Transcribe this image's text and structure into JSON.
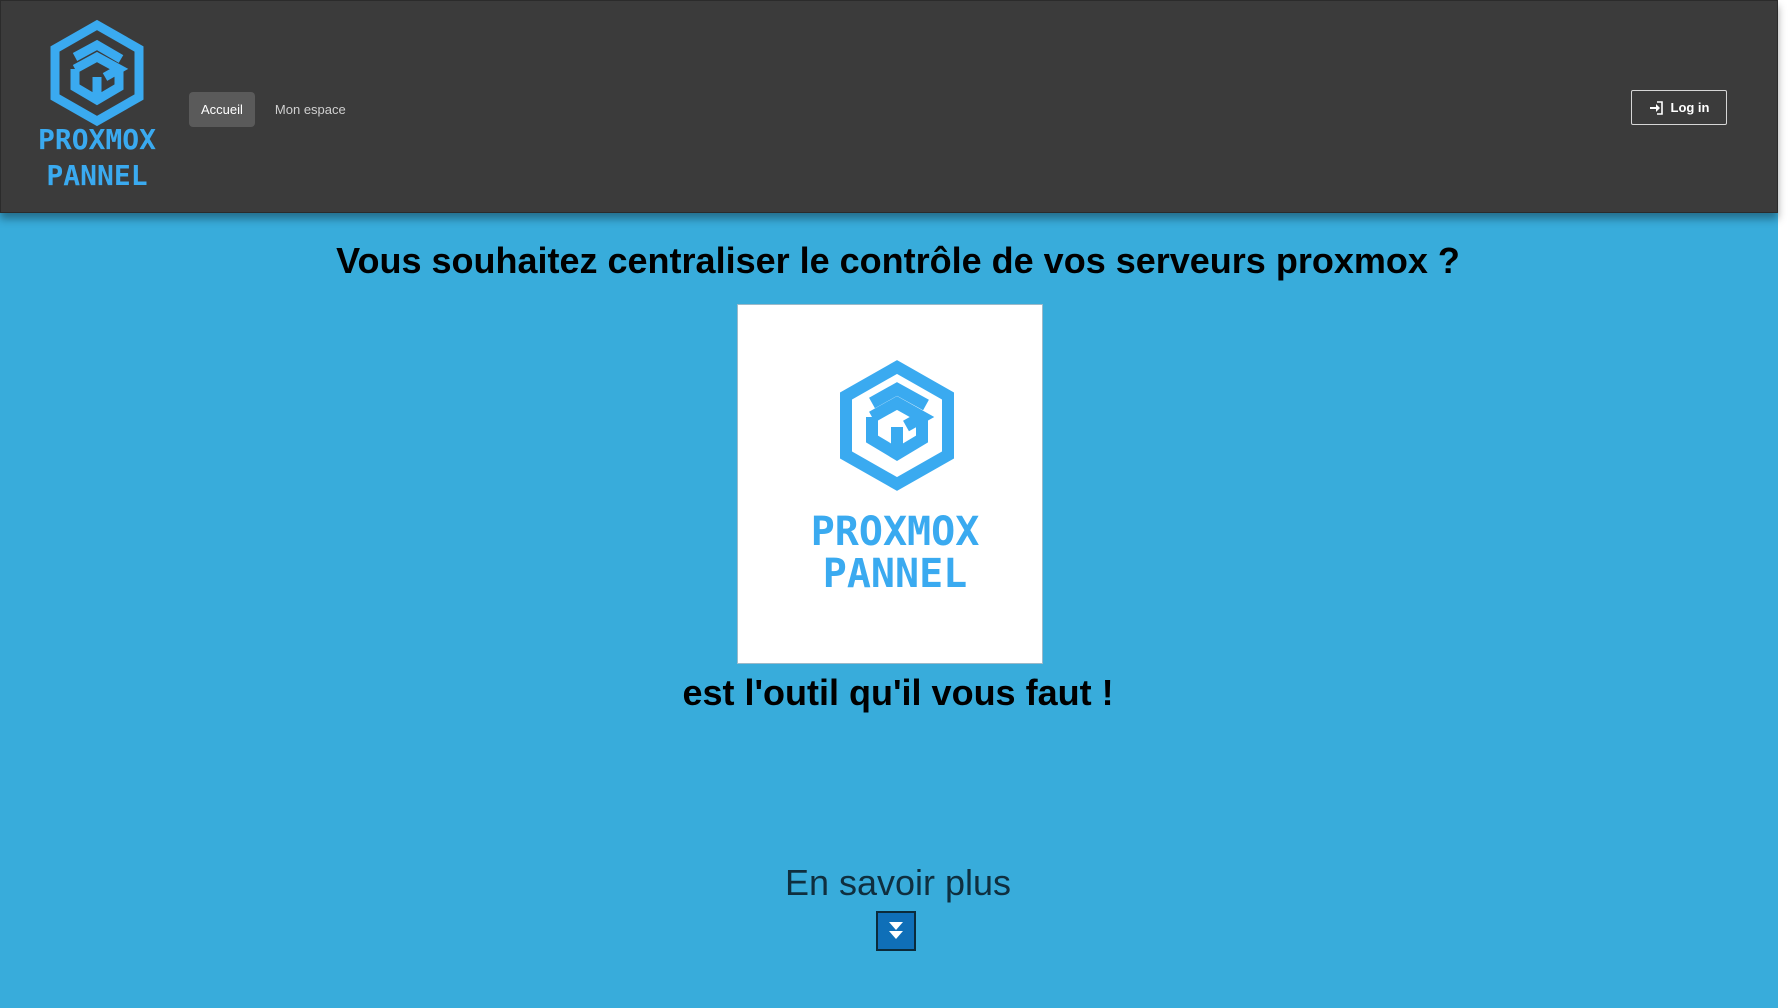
{
  "brand": {
    "logo_line1": "PROXMOX",
    "logo_line2": "PANNEL",
    "icon": "proxmox-pannel-cube-icon",
    "accent_color": "#3aaaf0"
  },
  "nav": {
    "items": [
      {
        "label": "Accueil",
        "active": true
      },
      {
        "label": "Mon espace",
        "active": false
      }
    ]
  },
  "login": {
    "label": "Log in",
    "icon": "sign-in-icon"
  },
  "hero": {
    "headline": "Vous souhaitez centraliser le contrôle de vos serveurs proxmox ?",
    "tagline": "est l'outil qu'il vous faut !",
    "logo_line1": "PROXMOX",
    "logo_line2": "PANNEL"
  },
  "more": {
    "label": "En savoir plus",
    "icon": "double-chevron-down-icon"
  },
  "colors": {
    "page_background": "#38acdb",
    "navbar_background": "#3b3b3b",
    "logo_blue": "#3aaaf0"
  }
}
